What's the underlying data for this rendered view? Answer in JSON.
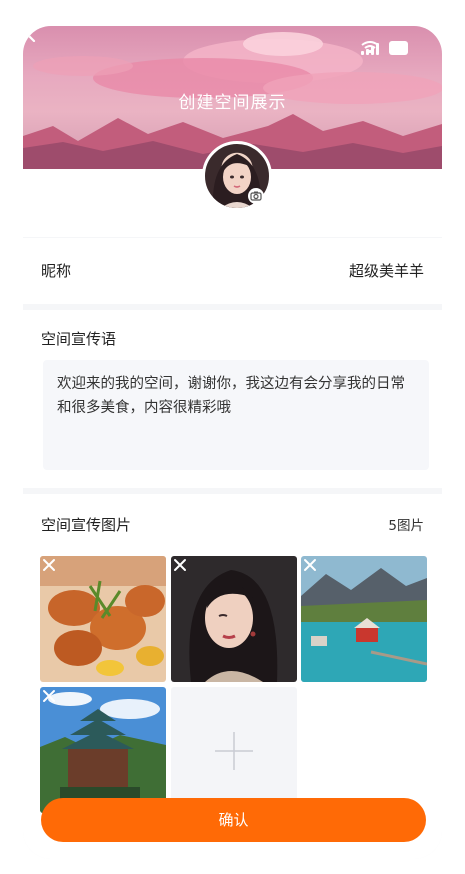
{
  "header": {
    "title": "创建空间展示"
  },
  "profile": {
    "nickname_label": "昵称",
    "nickname_value": "超级美羊羊"
  },
  "slogan": {
    "label": "空间宣传语",
    "text": "欢迎来的我的空间，谢谢你，我这边有会分享我的日常和很多美食，内容很精彩哦"
  },
  "images": {
    "label": "空间宣传图片",
    "count": "5图片",
    "items": [
      {
        "name": "fried-chicken-photo"
      },
      {
        "name": "woman-portrait-photo"
      },
      {
        "name": "lake-houses-photo"
      },
      {
        "name": "pagoda-photo"
      }
    ]
  },
  "actions": {
    "confirm_label": "确认"
  },
  "colors": {
    "accent": "#ff6a06",
    "page_bg": "#f5f6f8"
  }
}
